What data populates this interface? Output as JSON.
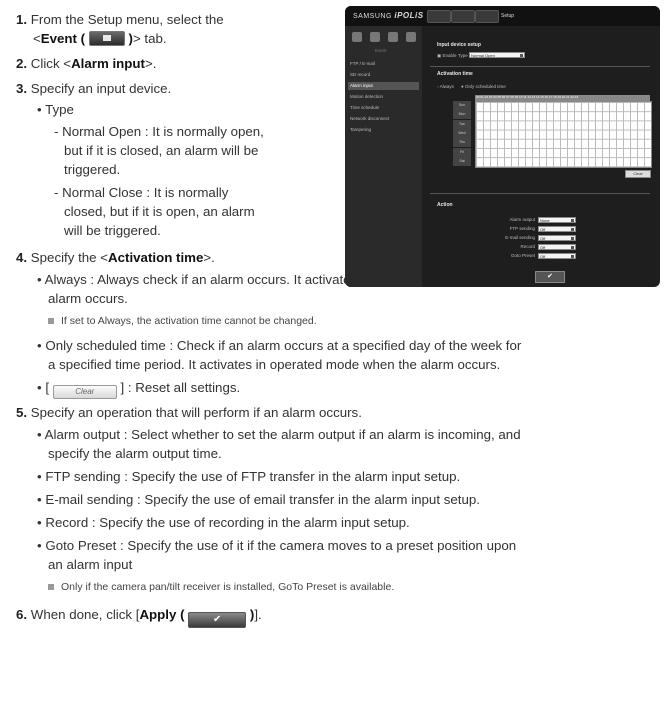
{
  "steps": {
    "s1": {
      "num": "1.",
      "line1": "From the Setup menu, select the",
      "line2_pre": "<",
      "event_label": "Event (",
      "event_close": ")",
      "line2_post": "> tab."
    },
    "s2": {
      "num": "2.",
      "pre": "Click <",
      "bold": "Alarm input",
      "post": ">."
    },
    "s3": {
      "num": "3.",
      "text": "Specify an input device."
    },
    "s3_type": "Type",
    "s3_no": [
      "- Normal Open : It is normally open,",
      "but if it is closed, an alarm will be",
      "triggered."
    ],
    "s3_nc": [
      "- Normal Close : It is normally",
      "closed, but if it is open, an alarm",
      "will be triggered."
    ],
    "s4": {
      "num": "4.",
      "pre": "Specify the <",
      "bold": "Activation time",
      "post": ">."
    },
    "s4_always": [
      "Always : Always check if an alarm occurs. It activates in operated mode when the",
      "alarm occurs."
    ],
    "s4_note": "If set to Always, the activation time cannot be changed.",
    "s4_sched": [
      "Only scheduled time : Check if an alarm occurs at a specified day of the week for",
      "a specified time period. It activates in operated mode when the alarm occurs."
    ],
    "s4_clear": {
      "pre": "[",
      "btn": "Clear",
      "post": "] : Reset all settings."
    },
    "s5": {
      "num": "5.",
      "text": "Specify an operation that will perform if an alarm occurs."
    },
    "s5_items": [
      [
        "Alarm output : Select whether to set the alarm output if an alarm is incoming, and",
        "specify the alarm output time."
      ],
      [
        "FTP sending : Specify the use of FTP transfer in the alarm input setup."
      ],
      [
        "E-mail sending : Specify the use of email transfer in the alarm input setup."
      ],
      [
        "Record : Specify the use of recording in the alarm input setup."
      ],
      [
        "Goto Preset : Specify the use of it if the camera moves to a preset position upon",
        "an alarm input"
      ]
    ],
    "s5_note": "Only if the camera pan/tilt receiver is installed, GoTo Preset is available.",
    "s6": {
      "num": "6.",
      "pre": "When done, click [",
      "bold": "Apply (",
      "btn": "✔",
      "close": ")",
      "post": "]."
    }
  },
  "screenshot": {
    "logo_prefix": "SAMSUNG",
    "logo_brand": "iPOLiS",
    "tab_setup": "Setup",
    "side_group": "Event",
    "side_menu": [
      "FTP / E-mail",
      "SD record",
      "Alarm input",
      "Motion detection",
      "Time schedule",
      "Network disconnect",
      "Tampering"
    ],
    "active_index": 2,
    "section_input": "Input device setup",
    "enable_label": "Enable",
    "type_label": "Type",
    "type_value": "Normal Open",
    "section_activation": "Activation time",
    "opt_always": "Always",
    "opt_sched": "Only scheduled time",
    "hours": "00 01 02 03 04 05 06 07 08 09 10 11 12 13 14 15 16 17 18 19 20 21 22 23",
    "days": [
      "Sun",
      "Mon",
      "Tue",
      "Wed",
      "Thu",
      "Fri",
      "Sat"
    ],
    "clear_btn": "Clear",
    "section_action": "Action",
    "actions": [
      {
        "label": "Alarm output",
        "value": "None"
      },
      {
        "label": "FTP sending",
        "value": "Off"
      },
      {
        "label": "E-mail sending",
        "value": "Off"
      },
      {
        "label": "Record",
        "value": "Off"
      },
      {
        "label": "Goto Preset",
        "value": "Off"
      }
    ],
    "apply_btn": "✔"
  }
}
